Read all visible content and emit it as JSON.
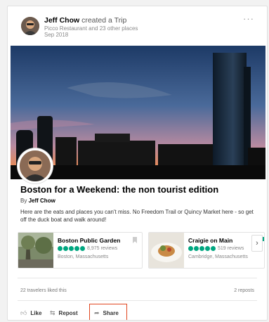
{
  "header": {
    "user": "Jeff Chow",
    "action": "created a Trip",
    "places": "Picco Restaurant and 23 other places",
    "date": "Sep 2018",
    "more": "···"
  },
  "trip": {
    "title": "Boston for a Weekend: the non tourist edition",
    "by_prefix": "By",
    "author": "Jeff Chow",
    "description": "Here are the eats and places you can't miss. No Freedom Trail or Quincy Market here - so get off the duck boat and walk around!"
  },
  "places": [
    {
      "name": "Boston Public Garden",
      "reviews": "8,975 reviews",
      "location": "Boston, Massachusetts",
      "rating": 5
    },
    {
      "name": "Craigie on Main",
      "reviews": "519 reviews",
      "location": "Cambridge, Massachusetts",
      "rating": 5
    }
  ],
  "next_arrow": "›",
  "stats": {
    "likes": "22 travelers liked this",
    "reposts": "2 reposts"
  },
  "actions": {
    "like": "Like",
    "repost": "Repost",
    "share": "Share"
  },
  "colors": {
    "accent_green": "#00a680",
    "highlight_box": "#e0451f"
  }
}
